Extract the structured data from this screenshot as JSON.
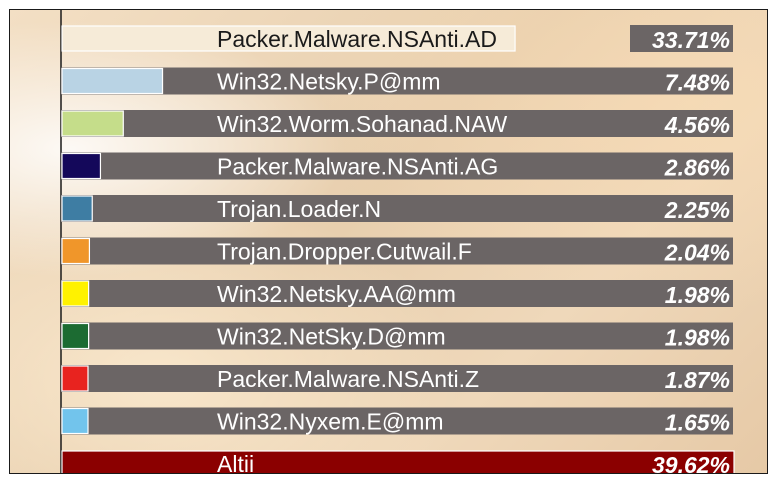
{
  "chart_data": {
    "type": "bar",
    "orientation": "horizontal",
    "categories": [
      "Packer.Malware.NSAnti.AD",
      "Win32.Netsky.P@mm",
      "Win32.Worm.Sohanad.NAW",
      "Packer.Malware.NSAnti.AG",
      "Trojan.Loader.N",
      "Trojan.Dropper.Cutwail.F",
      "Win32.Netsky.AA@mm",
      "Win32.NetSky.D@mm",
      "Packer.Malware.NSAnti.Z",
      "Win32.Nyxem.E@mm",
      "Altii"
    ],
    "values": [
      33.71,
      7.48,
      4.56,
      2.86,
      2.25,
      2.04,
      1.98,
      1.98,
      1.87,
      1.65,
      39.62
    ],
    "value_labels": [
      "33.71%",
      "7.48%",
      "4.56%",
      "2.86%",
      "2.25%",
      "2.04%",
      "1.98%",
      "1.98%",
      "1.87%",
      "1.65%",
      "39.62%"
    ],
    "colors": [
      "#f6ebd8",
      "#b9d3e4",
      "#c5dd8a",
      "#14085a",
      "#3e7da3",
      "#f0962a",
      "#fff200",
      "#1c6b32",
      "#e8231f",
      "#72c4ec",
      "#8b0000"
    ],
    "track_color": "#6b6565",
    "xlim": [
      0,
      40
    ],
    "grid": false,
    "legend": "none"
  }
}
